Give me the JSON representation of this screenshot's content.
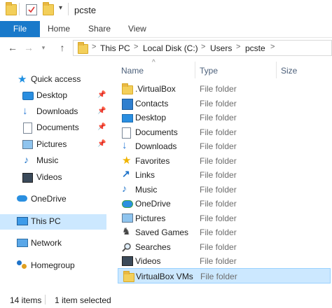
{
  "window": {
    "title": "pcste"
  },
  "ribbon": {
    "tabs": [
      "File",
      "Home",
      "Share",
      "View"
    ]
  },
  "address": {
    "crumbs": [
      "This PC",
      "Local Disk (C:)",
      "Users",
      "pcste"
    ],
    "separator": ">"
  },
  "nav": {
    "items": [
      {
        "label": "Quick access",
        "icon": "star-icon",
        "pinned": false
      },
      {
        "label": "Desktop",
        "icon": "desktop-icon",
        "pinned": true
      },
      {
        "label": "Downloads",
        "icon": "download-arrow-icon",
        "pinned": true
      },
      {
        "label": "Documents",
        "icon": "documents-icon",
        "pinned": true
      },
      {
        "label": "Pictures",
        "icon": "pictures-icon",
        "pinned": true
      },
      {
        "label": "Music",
        "icon": "music-icon",
        "pinned": false
      },
      {
        "label": "Videos",
        "icon": "videos-icon",
        "pinned": false
      },
      {
        "label": "OneDrive",
        "icon": "cloud-icon",
        "pinned": false
      },
      {
        "label": "This PC",
        "icon": "computer-icon",
        "pinned": false,
        "selected": true
      },
      {
        "label": "Network",
        "icon": "network-icon",
        "pinned": false
      },
      {
        "label": "Homegroup",
        "icon": "homegroup-icon",
        "pinned": false
      }
    ]
  },
  "columns": {
    "name": "Name",
    "type": "Type",
    "size": "Size"
  },
  "files": [
    {
      "name": ".VirtualBox",
      "type": "File folder",
      "icon": "folder-icon"
    },
    {
      "name": "Contacts",
      "type": "File folder",
      "icon": "contacts-icon"
    },
    {
      "name": "Desktop",
      "type": "File folder",
      "icon": "desktop-icon"
    },
    {
      "name": "Documents",
      "type": "File folder",
      "icon": "documents-icon"
    },
    {
      "name": "Downloads",
      "type": "File folder",
      "icon": "download-arrow-icon"
    },
    {
      "name": "Favorites",
      "type": "File folder",
      "icon": "favorites-star-icon"
    },
    {
      "name": "Links",
      "type": "File folder",
      "icon": "links-icon"
    },
    {
      "name": "Music",
      "type": "File folder",
      "icon": "music-icon"
    },
    {
      "name": "OneDrive",
      "type": "File folder",
      "icon": "onedrive-icon"
    },
    {
      "name": "Pictures",
      "type": "File folder",
      "icon": "pictures-icon"
    },
    {
      "name": "Saved Games",
      "type": "File folder",
      "icon": "saved-games-icon"
    },
    {
      "name": "Searches",
      "type": "File folder",
      "icon": "search-icon"
    },
    {
      "name": "Videos",
      "type": "File folder",
      "icon": "videos-icon"
    },
    {
      "name": "VirtualBox VMs",
      "type": "File folder",
      "icon": "folder-icon",
      "selected": true
    }
  ],
  "status": {
    "count": "14 items",
    "selection": "1 item selected"
  },
  "colors": {
    "accent": "#1979ca",
    "selection": "#cce8ff",
    "selection_border": "#99d1ff",
    "folder": "#f3cf5a"
  }
}
